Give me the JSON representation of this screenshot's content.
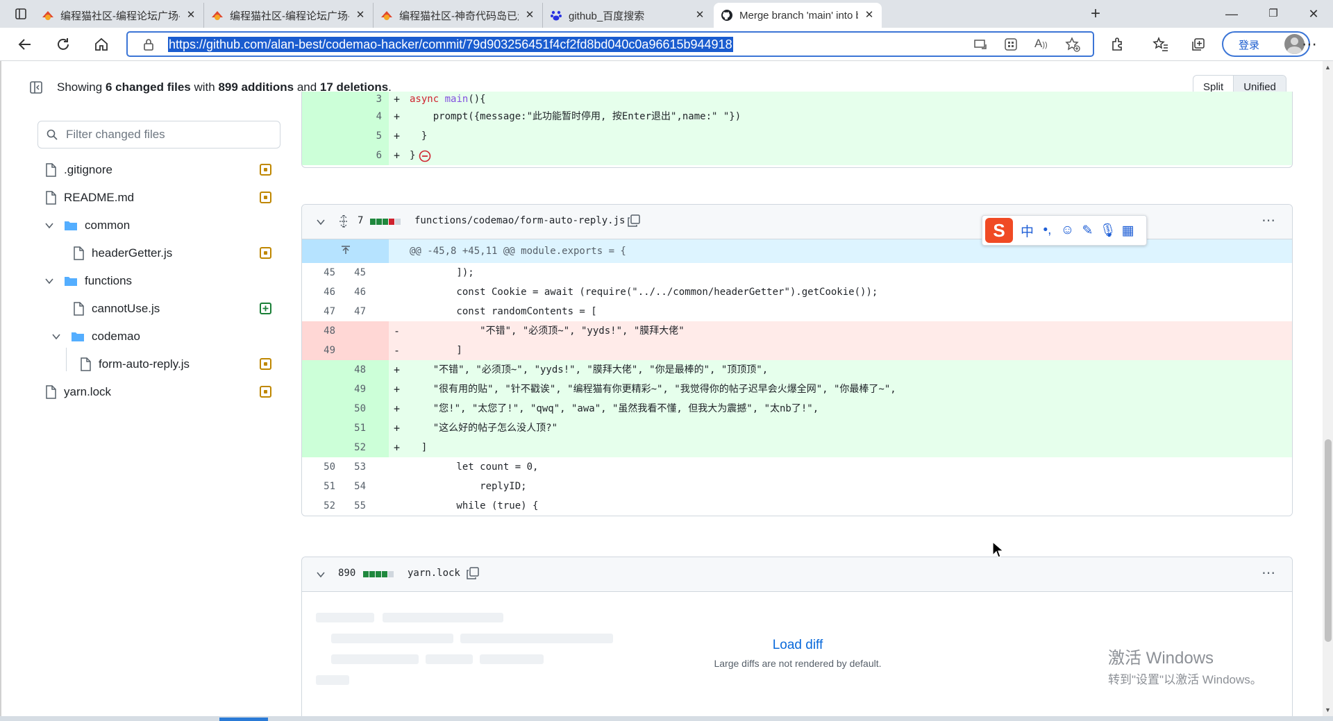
{
  "browser": {
    "tabs": [
      {
        "title": "编程猫社区-编程论坛广场-编程",
        "icon": "codemao-icon"
      },
      {
        "title": "编程猫社区-编程论坛广场-编程",
        "icon": "codemao-icon"
      },
      {
        "title": "编程猫社区-神奇代码岛已走向",
        "icon": "codemao-icon"
      },
      {
        "title": "github_百度搜索",
        "icon": "baidu-icon"
      },
      {
        "title": "Merge branch 'main' into bcmra",
        "icon": "github-icon"
      }
    ],
    "url": "https://github.com/alan-best/codemao-hacker/commit/79d903256451f4cf2fd8bd040c0a96615b944918",
    "login_label": "登录"
  },
  "summary": {
    "prefix": "Showing ",
    "files": "6 changed files",
    "mid1": " with ",
    "additions": "899 additions",
    "mid2": " and ",
    "deletions": "17 deletions",
    "suffix": "."
  },
  "view_toggle": {
    "split": "Split",
    "unified": "Unified"
  },
  "filter_placeholder": "Filter changed files",
  "file_tree": [
    {
      "name": ".gitignore",
      "type": "file",
      "status": "modified"
    },
    {
      "name": "README.md",
      "type": "file",
      "status": "modified"
    },
    {
      "name": "common",
      "type": "folder"
    },
    {
      "name": "headerGetter.js",
      "type": "file",
      "status": "modified"
    },
    {
      "name": "functions",
      "type": "folder"
    },
    {
      "name": "cannotUse.js",
      "type": "file",
      "status": "added"
    },
    {
      "name": "codemao",
      "type": "folder"
    },
    {
      "name": "form-auto-reply.js",
      "type": "file",
      "status": "modified"
    },
    {
      "name": "yarn.lock",
      "type": "file",
      "status": "modified"
    }
  ],
  "prev_diff_tail": [
    {
      "new": "3",
      "sign": "+",
      "code": "  async main(){"
    },
    {
      "new": "4",
      "sign": "+",
      "code": "    prompt({message:\"此功能暂时停用, 按Enter退出\",name:\" \"})"
    },
    {
      "new": "5",
      "sign": "+",
      "code": "  }"
    },
    {
      "new": "6",
      "sign": "+",
      "code": "}"
    }
  ],
  "file2": {
    "count": "7",
    "bars": [
      "g",
      "g",
      "g",
      "r",
      "n"
    ],
    "path": "functions/codemao/form-auto-reply.js",
    "hunk": "@@ -45,8 +45,11 @@ module.exports = {",
    "lines": [
      {
        "type": "ctx",
        "old": "45",
        "new": "45",
        "sign": "",
        "code": "        ]);"
      },
      {
        "type": "ctx",
        "old": "46",
        "new": "46",
        "sign": "",
        "code": "        const Cookie = await (require(\"../../common/headerGetter\").getCookie());"
      },
      {
        "type": "ctx",
        "old": "47",
        "new": "47",
        "sign": "",
        "code": "        const randomContents = ["
      },
      {
        "type": "del",
        "old": "48",
        "new": "",
        "sign": "-",
        "code": "            \"不错\", \"必须顶~\", \"yyds!\", \"膜拜大佬\""
      },
      {
        "type": "del",
        "old": "49",
        "new": "",
        "sign": "-",
        "code": "        ]"
      },
      {
        "type": "add",
        "old": "",
        "new": "48",
        "sign": "+",
        "code": "    \"不错\", \"必须顶~\", \"yyds!\", \"膜拜大佬\", \"你是最棒的\", \"顶顶顶\","
      },
      {
        "type": "add",
        "old": "",
        "new": "49",
        "sign": "+",
        "code": "    \"很有用的贴\", \"针不戳诶\", \"编程猫有你更精彩~\", \"我觉得你的帖子迟早会火爆全网\", \"你最棒了~\","
      },
      {
        "type": "add",
        "old": "",
        "new": "50",
        "sign": "+",
        "code": "    \"您!\", \"太您了!\", \"qwq\", \"awa\", \"虽然我看不懂, 但我大为震撼\", \"太nb了!\","
      },
      {
        "type": "add",
        "old": "",
        "new": "51",
        "sign": "+",
        "code": "    \"这么好的帖子怎么没人顶?\""
      },
      {
        "type": "add",
        "old": "",
        "new": "52",
        "sign": "+",
        "code": "  ]"
      },
      {
        "type": "ctx",
        "old": "50",
        "new": "53",
        "sign": "",
        "code": "        let count = 0,"
      },
      {
        "type": "ctx",
        "old": "51",
        "new": "54",
        "sign": "",
        "code": "            replyID;"
      },
      {
        "type": "ctx",
        "old": "52",
        "new": "55",
        "sign": "",
        "code": "        while (true) {"
      }
    ]
  },
  "file3": {
    "count": "890",
    "bars": [
      "g",
      "g",
      "g",
      "g",
      "n"
    ],
    "path": "yarn.lock",
    "load_diff": "Load diff",
    "load_note": "Large diffs are not rendered by default."
  },
  "watermark": {
    "line1": "激活 Windows",
    "line2": "转到\"设置\"以激活 Windows。"
  }
}
